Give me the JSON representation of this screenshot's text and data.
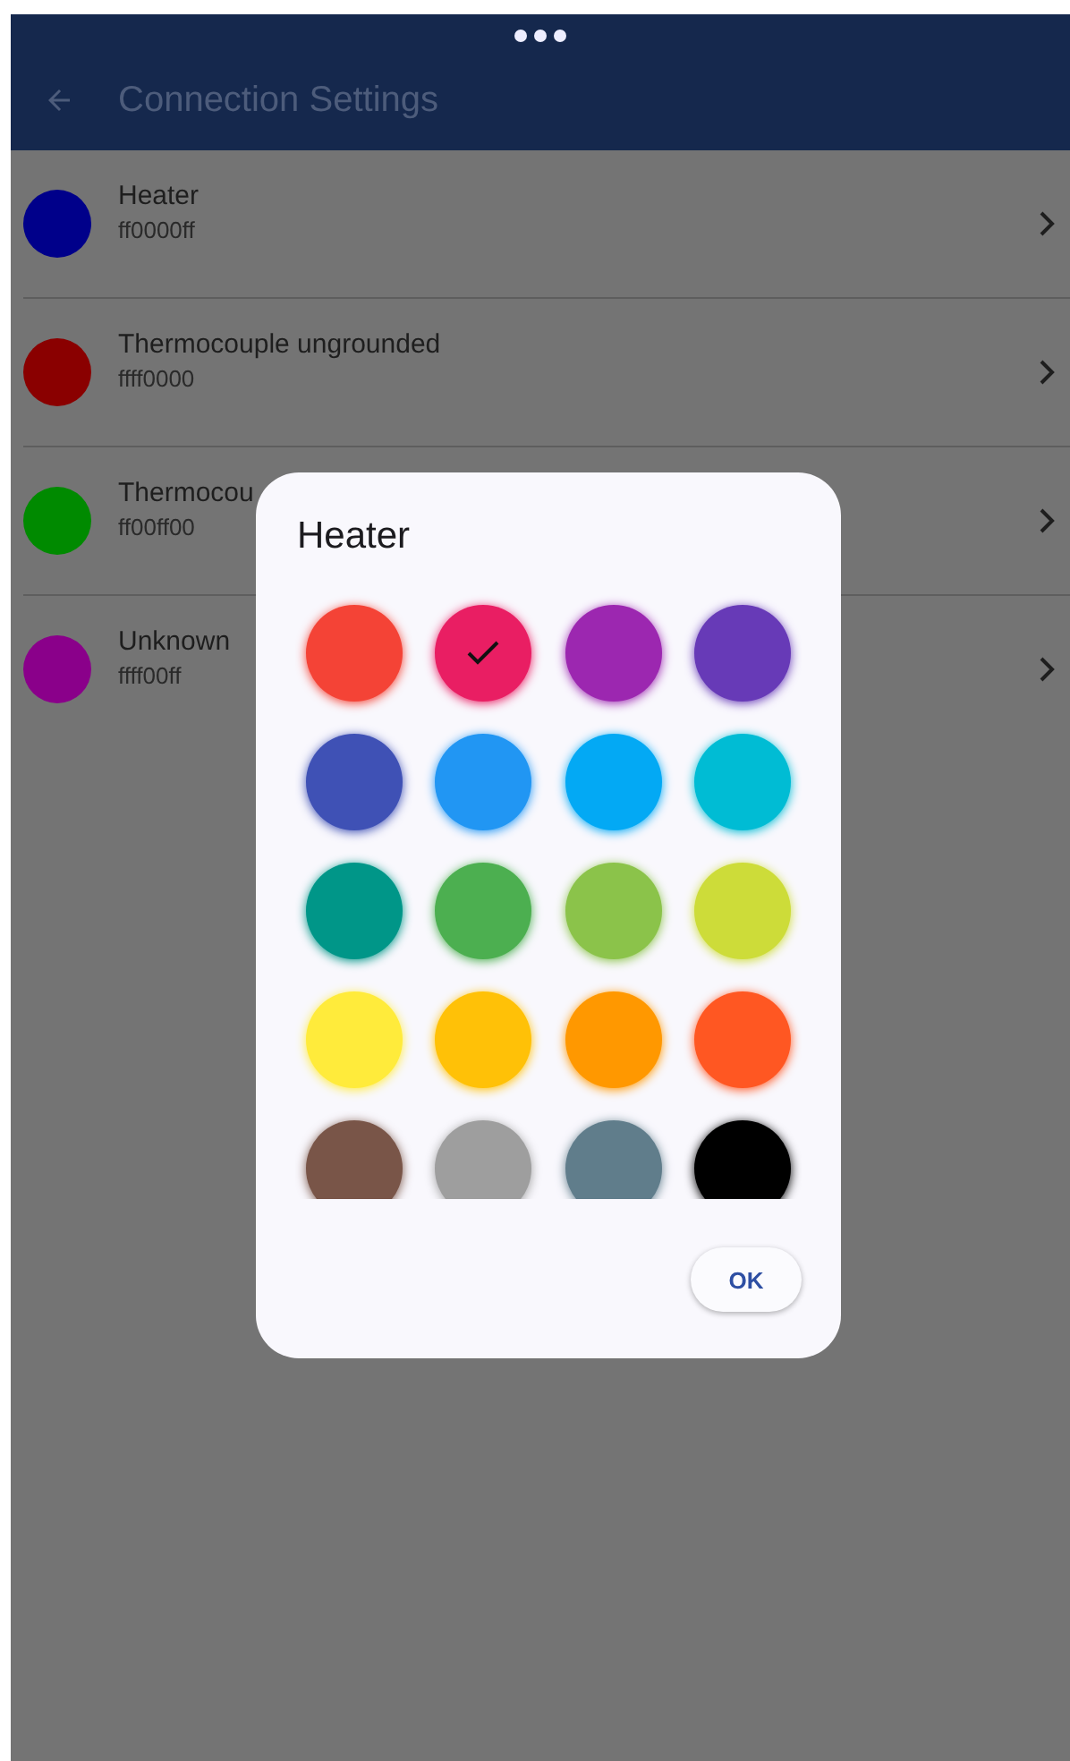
{
  "app_bar": {
    "title": "Connection Settings"
  },
  "items": [
    {
      "name": "Heater",
      "code": "ff0000ff",
      "color": "#00008a"
    },
    {
      "name": "Thermocouple ungrounded",
      "code": "ffff0000",
      "color": "#8a0000"
    },
    {
      "name": "Thermocou",
      "code": "ff00ff00",
      "color": "#008a00"
    },
    {
      "name": "Unknown",
      "code": "ffff00ff",
      "color": "#8a008a"
    }
  ],
  "dialog": {
    "title": "Heater",
    "button": "OK",
    "swatches": [
      {
        "color": "#f44336",
        "selected": false
      },
      {
        "color": "#e91e63",
        "selected": true
      },
      {
        "color": "#9c27b0",
        "selected": false
      },
      {
        "color": "#673ab7",
        "selected": false
      },
      {
        "color": "#3f51b5",
        "selected": false
      },
      {
        "color": "#2196f3",
        "selected": false
      },
      {
        "color": "#03a9f4",
        "selected": false
      },
      {
        "color": "#00bcd4",
        "selected": false
      },
      {
        "color": "#009688",
        "selected": false
      },
      {
        "color": "#4caf50",
        "selected": false
      },
      {
        "color": "#8bc34a",
        "selected": false
      },
      {
        "color": "#cddc39",
        "selected": false
      },
      {
        "color": "#ffeb3b",
        "selected": false
      },
      {
        "color": "#ffc107",
        "selected": false
      },
      {
        "color": "#ff9800",
        "selected": false
      },
      {
        "color": "#ff5722",
        "selected": false
      },
      {
        "color": "#795548",
        "selected": false
      },
      {
        "color": "#9e9e9e",
        "selected": false
      },
      {
        "color": "#607d8b",
        "selected": false
      },
      {
        "color": "#000000",
        "selected": false
      }
    ]
  }
}
